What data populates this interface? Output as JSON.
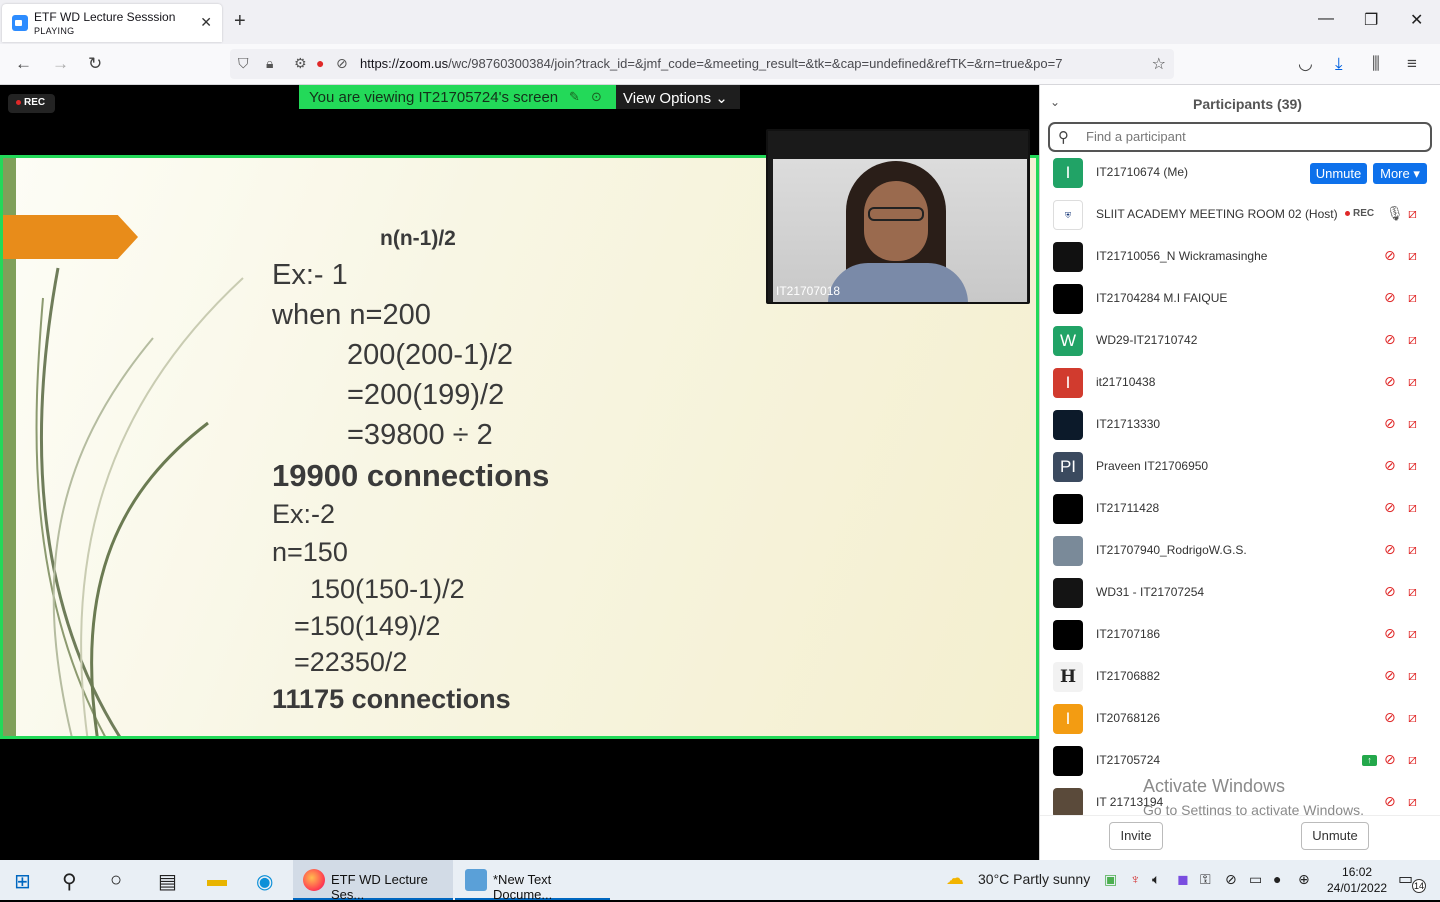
{
  "browser": {
    "tab_title": "ETF WD Lecture Sesssion",
    "tab_status": "PLAYING",
    "url_domain": "https://zoom.us",
    "url_rest": "/wc/98760300384/join?track_id=&jmf_code=&meeting_result=&tk=&cap=undefined&refTK=&rn=true&po=7"
  },
  "meeting": {
    "rec_label": "REC",
    "viewing_text": "You are viewing IT21705724's screen",
    "view_options": "View Options",
    "video_name": "IT21707018"
  },
  "slide": {
    "lines": [
      "n(n-1)/2",
      "Ex:- 1",
      "when n=200",
      "200(200-1)/2",
      "=200(199)/2",
      "=39800 ÷ 2",
      "19900 connections",
      "Ex:-2",
      "n=150",
      "150(150-1)/2",
      "=150(149)/2",
      "=22350/2",
      "11175 connections"
    ]
  },
  "participants": {
    "title": "Participants (39)",
    "search_placeholder": "Find a participant",
    "unmute_label": "Unmute",
    "more_label": "More",
    "rec_label": "REC",
    "list": [
      {
        "name": "IT21710674 (Me)",
        "initial": "I",
        "color": "#21a366"
      },
      {
        "name": "SLIIT ACADEMY MEETING ROOM 02 (Host)",
        "initial": "",
        "color": "#ffffff"
      },
      {
        "name": "IT21710056_N Wickramasinghe",
        "initial": "",
        "color": "#111111"
      },
      {
        "name": "IT21704284 M.I FAIQUE",
        "initial": "",
        "color": "#000000"
      },
      {
        "name": "WD29-IT21710742",
        "initial": "W",
        "color": "#21a366"
      },
      {
        "name": "it21710438",
        "initial": "I",
        "color": "#d13b2e"
      },
      {
        "name": "IT21713330",
        "initial": "",
        "color": "#0c1a2a"
      },
      {
        "name": "Praveen IT21706950",
        "initial": "PI",
        "color": "#3b4a5f"
      },
      {
        "name": "IT21711428",
        "initial": "",
        "color": "#000000"
      },
      {
        "name": "IT21707940_RodrigoW.G.S.",
        "initial": "",
        "color": "#7a8a99"
      },
      {
        "name": "WD31 - IT21707254",
        "initial": "",
        "color": "#141414"
      },
      {
        "name": "IT21707186",
        "initial": "",
        "color": "#000000"
      },
      {
        "name": "IT21706882",
        "initial": "H",
        "color": "#f2f2f2"
      },
      {
        "name": "IT20768126",
        "initial": "I",
        "color": "#f39c12"
      },
      {
        "name": "IT21705724",
        "initial": "",
        "color": "#000000"
      },
      {
        "name": "IT 21713194",
        "initial": "",
        "color": "#5a4a3a"
      }
    ],
    "activate_title": "Activate Windows",
    "activate_sub": "Go to Settings to activate Windows.",
    "invite_label": "Invite",
    "footer_unmute": "Unmute"
  },
  "taskbar": {
    "app1": "ETF WD Lecture Ses...",
    "app2": "*New Text Docume...",
    "weather": "30°C  Partly sunny",
    "time": "16:02",
    "date": "24/01/2022",
    "notif_count": "14"
  }
}
